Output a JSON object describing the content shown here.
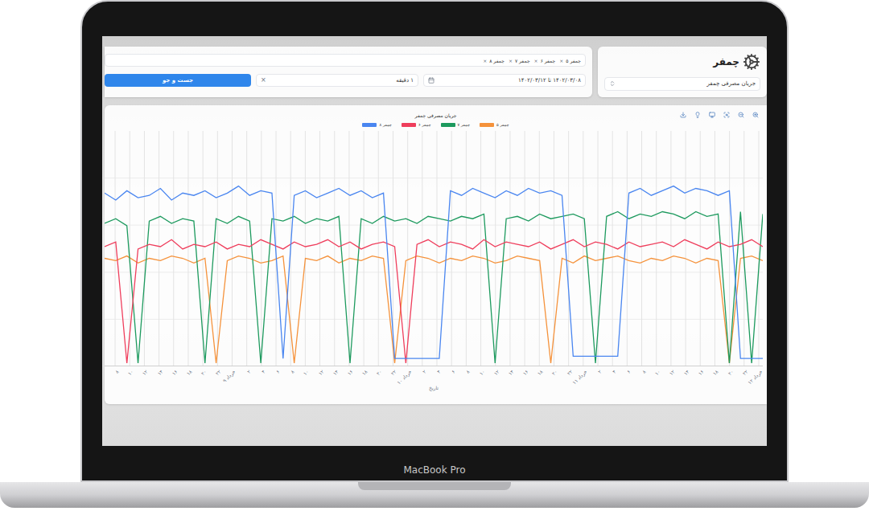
{
  "device": {
    "label": "MacBook Pro"
  },
  "header": {
    "logo_text": "چمفر",
    "select": {
      "value": "جریان مصرفی چمفر"
    }
  },
  "filters": {
    "chips": [
      {
        "label": "چمفر ۵",
        "remove": "×"
      },
      {
        "label": "چمفر ۶",
        "remove": "×"
      },
      {
        "label": "چمفر ۷",
        "remove": "×"
      },
      {
        "label": "چمفر ۸",
        "remove": "×"
      }
    ],
    "date_range": "۱۴۰۲/۰۳/۰۸ تا ۱۴۰۲/۰۳/۱۲",
    "interval": {
      "value": "۱ دقیقه",
      "clear": "×"
    },
    "search_button": "جست و جو"
  },
  "chart": {
    "title": "جریان مصرفی چمفر",
    "x_axis_label": "تاریخ",
    "x_ticks": [
      "۸",
      "۱۰",
      "۱۲",
      "۱۴",
      "۱۶",
      "۱۸",
      "۲۰",
      "۲۲",
      "۹ خرداد",
      "۲",
      "۴",
      "۶",
      "۸",
      "۱۰",
      "۱۲",
      "۱۴",
      "۱۶",
      "۱۸",
      "۲۰",
      "۲۲",
      "۱۰ خرداد",
      "۲",
      "۴",
      "۶",
      "۸",
      "۱۰",
      "۱۲",
      "۱۴",
      "۱۶",
      "۱۸",
      "۲۰",
      "۲۲",
      "۱۱ خرداد",
      "۲",
      "۴",
      "۶",
      "۸",
      "۱۰",
      "۱۲",
      "۱۴",
      "۱۶",
      "۱۸",
      "۲۰",
      "۲۲",
      "۱۲ خرداد"
    ],
    "series": [
      {
        "name": "چمفر ۵",
        "color": "#f5923b",
        "values": [
          45,
          44,
          46,
          43,
          45,
          44,
          46,
          45,
          43,
          45,
          0,
          44,
          46,
          45,
          43,
          44,
          46,
          0,
          45,
          44,
          46,
          43,
          45,
          44,
          46,
          45,
          0,
          44,
          46,
          45,
          43,
          45,
          44,
          46,
          45,
          43,
          44,
          46,
          45,
          44,
          0,
          45,
          43,
          46,
          44,
          45,
          46,
          44,
          43,
          45,
          44,
          46,
          45,
          43,
          45,
          44,
          0,
          45,
          46,
          44
        ]
      },
      {
        "name": "چمفر ۷",
        "color": "#1d9a5e",
        "values": [
          60,
          62,
          59,
          0,
          61,
          63,
          60,
          62,
          61,
          0,
          62,
          60,
          63,
          61,
          0,
          62,
          61,
          63,
          60,
          62,
          61,
          63,
          0,
          62,
          60,
          63,
          61,
          62,
          60,
          63,
          62,
          61,
          63,
          62,
          64,
          0,
          62,
          63,
          61,
          64,
          62,
          63,
          64,
          62,
          0,
          63,
          65,
          62,
          64,
          63,
          65,
          64,
          62,
          65,
          63,
          64,
          0,
          65,
          0,
          64
        ]
      },
      {
        "name": "چمفر ۶",
        "color": "#ef3e5c",
        "values": [
          50,
          52,
          0,
          49,
          51,
          50,
          53,
          49,
          51,
          50,
          52,
          49,
          51,
          50,
          53,
          51,
          49,
          52,
          50,
          51,
          53,
          50,
          52,
          49,
          51,
          52,
          50,
          0,
          51,
          53,
          50,
          52,
          51,
          49,
          53,
          50,
          52,
          51,
          50,
          52,
          49,
          51,
          53,
          50,
          52,
          51,
          49,
          52,
          50,
          51,
          52,
          50,
          53,
          51,
          49,
          52,
          50,
          51,
          53,
          50
        ]
      },
      {
        "name": "چمفر ۸",
        "color": "#4a86f0",
        "values": [
          73,
          70,
          74,
          71,
          72,
          75,
          70,
          73,
          72,
          74,
          71,
          73,
          76,
          72,
          74,
          73,
          2,
          72,
          74,
          71,
          73,
          75,
          72,
          74,
          71,
          73,
          2,
          2,
          2,
          2,
          2,
          74,
          72,
          75,
          73,
          71,
          74,
          72,
          75,
          73,
          74,
          72,
          3,
          3,
          3,
          3,
          3,
          73,
          75,
          72,
          74,
          76,
          73,
          75,
          74,
          72,
          74,
          2,
          2,
          2
        ]
      }
    ]
  }
}
